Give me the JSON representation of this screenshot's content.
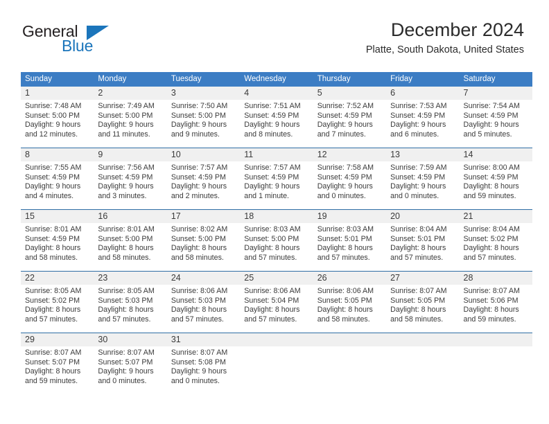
{
  "brand": {
    "name_part1": "General",
    "name_part2": "Blue",
    "triangle_icon": "blue-triangle-icon",
    "colors": {
      "dark": "#231f20",
      "blue": "#1b75bb"
    }
  },
  "header": {
    "title": "December 2024",
    "subtitle": "Platte, South Dakota, United States"
  },
  "theme": {
    "header_bar": "#3c7dc4",
    "week_rule": "#2e6da4",
    "daynum_band": "#f0f0f0",
    "text": "#3a3a3a"
  },
  "day_headers": [
    "Sunday",
    "Monday",
    "Tuesday",
    "Wednesday",
    "Thursday",
    "Friday",
    "Saturday"
  ],
  "weeks": [
    [
      {
        "day": "1",
        "sunrise": "Sunrise: 7:48 AM",
        "sunset": "Sunset: 5:00 PM",
        "daylight1": "Daylight: 9 hours",
        "daylight2": "and 12 minutes."
      },
      {
        "day": "2",
        "sunrise": "Sunrise: 7:49 AM",
        "sunset": "Sunset: 5:00 PM",
        "daylight1": "Daylight: 9 hours",
        "daylight2": "and 11 minutes."
      },
      {
        "day": "3",
        "sunrise": "Sunrise: 7:50 AM",
        "sunset": "Sunset: 5:00 PM",
        "daylight1": "Daylight: 9 hours",
        "daylight2": "and 9 minutes."
      },
      {
        "day": "4",
        "sunrise": "Sunrise: 7:51 AM",
        "sunset": "Sunset: 4:59 PM",
        "daylight1": "Daylight: 9 hours",
        "daylight2": "and 8 minutes."
      },
      {
        "day": "5",
        "sunrise": "Sunrise: 7:52 AM",
        "sunset": "Sunset: 4:59 PM",
        "daylight1": "Daylight: 9 hours",
        "daylight2": "and 7 minutes."
      },
      {
        "day": "6",
        "sunrise": "Sunrise: 7:53 AM",
        "sunset": "Sunset: 4:59 PM",
        "daylight1": "Daylight: 9 hours",
        "daylight2": "and 6 minutes."
      },
      {
        "day": "7",
        "sunrise": "Sunrise: 7:54 AM",
        "sunset": "Sunset: 4:59 PM",
        "daylight1": "Daylight: 9 hours",
        "daylight2": "and 5 minutes."
      }
    ],
    [
      {
        "day": "8",
        "sunrise": "Sunrise: 7:55 AM",
        "sunset": "Sunset: 4:59 PM",
        "daylight1": "Daylight: 9 hours",
        "daylight2": "and 4 minutes."
      },
      {
        "day": "9",
        "sunrise": "Sunrise: 7:56 AM",
        "sunset": "Sunset: 4:59 PM",
        "daylight1": "Daylight: 9 hours",
        "daylight2": "and 3 minutes."
      },
      {
        "day": "10",
        "sunrise": "Sunrise: 7:57 AM",
        "sunset": "Sunset: 4:59 PM",
        "daylight1": "Daylight: 9 hours",
        "daylight2": "and 2 minutes."
      },
      {
        "day": "11",
        "sunrise": "Sunrise: 7:57 AM",
        "sunset": "Sunset: 4:59 PM",
        "daylight1": "Daylight: 9 hours",
        "daylight2": "and 1 minute."
      },
      {
        "day": "12",
        "sunrise": "Sunrise: 7:58 AM",
        "sunset": "Sunset: 4:59 PM",
        "daylight1": "Daylight: 9 hours",
        "daylight2": "and 0 minutes."
      },
      {
        "day": "13",
        "sunrise": "Sunrise: 7:59 AM",
        "sunset": "Sunset: 4:59 PM",
        "daylight1": "Daylight: 9 hours",
        "daylight2": "and 0 minutes."
      },
      {
        "day": "14",
        "sunrise": "Sunrise: 8:00 AM",
        "sunset": "Sunset: 4:59 PM",
        "daylight1": "Daylight: 8 hours",
        "daylight2": "and 59 minutes."
      }
    ],
    [
      {
        "day": "15",
        "sunrise": "Sunrise: 8:01 AM",
        "sunset": "Sunset: 4:59 PM",
        "daylight1": "Daylight: 8 hours",
        "daylight2": "and 58 minutes."
      },
      {
        "day": "16",
        "sunrise": "Sunrise: 8:01 AM",
        "sunset": "Sunset: 5:00 PM",
        "daylight1": "Daylight: 8 hours",
        "daylight2": "and 58 minutes."
      },
      {
        "day": "17",
        "sunrise": "Sunrise: 8:02 AM",
        "sunset": "Sunset: 5:00 PM",
        "daylight1": "Daylight: 8 hours",
        "daylight2": "and 58 minutes."
      },
      {
        "day": "18",
        "sunrise": "Sunrise: 8:03 AM",
        "sunset": "Sunset: 5:00 PM",
        "daylight1": "Daylight: 8 hours",
        "daylight2": "and 57 minutes."
      },
      {
        "day": "19",
        "sunrise": "Sunrise: 8:03 AM",
        "sunset": "Sunset: 5:01 PM",
        "daylight1": "Daylight: 8 hours",
        "daylight2": "and 57 minutes."
      },
      {
        "day": "20",
        "sunrise": "Sunrise: 8:04 AM",
        "sunset": "Sunset: 5:01 PM",
        "daylight1": "Daylight: 8 hours",
        "daylight2": "and 57 minutes."
      },
      {
        "day": "21",
        "sunrise": "Sunrise: 8:04 AM",
        "sunset": "Sunset: 5:02 PM",
        "daylight1": "Daylight: 8 hours",
        "daylight2": "and 57 minutes."
      }
    ],
    [
      {
        "day": "22",
        "sunrise": "Sunrise: 8:05 AM",
        "sunset": "Sunset: 5:02 PM",
        "daylight1": "Daylight: 8 hours",
        "daylight2": "and 57 minutes."
      },
      {
        "day": "23",
        "sunrise": "Sunrise: 8:05 AM",
        "sunset": "Sunset: 5:03 PM",
        "daylight1": "Daylight: 8 hours",
        "daylight2": "and 57 minutes."
      },
      {
        "day": "24",
        "sunrise": "Sunrise: 8:06 AM",
        "sunset": "Sunset: 5:03 PM",
        "daylight1": "Daylight: 8 hours",
        "daylight2": "and 57 minutes."
      },
      {
        "day": "25",
        "sunrise": "Sunrise: 8:06 AM",
        "sunset": "Sunset: 5:04 PM",
        "daylight1": "Daylight: 8 hours",
        "daylight2": "and 57 minutes."
      },
      {
        "day": "26",
        "sunrise": "Sunrise: 8:06 AM",
        "sunset": "Sunset: 5:05 PM",
        "daylight1": "Daylight: 8 hours",
        "daylight2": "and 58 minutes."
      },
      {
        "day": "27",
        "sunrise": "Sunrise: 8:07 AM",
        "sunset": "Sunset: 5:05 PM",
        "daylight1": "Daylight: 8 hours",
        "daylight2": "and 58 minutes."
      },
      {
        "day": "28",
        "sunrise": "Sunrise: 8:07 AM",
        "sunset": "Sunset: 5:06 PM",
        "daylight1": "Daylight: 8 hours",
        "daylight2": "and 59 minutes."
      }
    ],
    [
      {
        "day": "29",
        "sunrise": "Sunrise: 8:07 AM",
        "sunset": "Sunset: 5:07 PM",
        "daylight1": "Daylight: 8 hours",
        "daylight2": "and 59 minutes."
      },
      {
        "day": "30",
        "sunrise": "Sunrise: 8:07 AM",
        "sunset": "Sunset: 5:07 PM",
        "daylight1": "Daylight: 9 hours",
        "daylight2": "and 0 minutes."
      },
      {
        "day": "31",
        "sunrise": "Sunrise: 8:07 AM",
        "sunset": "Sunset: 5:08 PM",
        "daylight1": "Daylight: 9 hours",
        "daylight2": "and 0 minutes."
      },
      {
        "day": "",
        "sunrise": "",
        "sunset": "",
        "daylight1": "",
        "daylight2": ""
      },
      {
        "day": "",
        "sunrise": "",
        "sunset": "",
        "daylight1": "",
        "daylight2": ""
      },
      {
        "day": "",
        "sunrise": "",
        "sunset": "",
        "daylight1": "",
        "daylight2": ""
      },
      {
        "day": "",
        "sunrise": "",
        "sunset": "",
        "daylight1": "",
        "daylight2": ""
      }
    ]
  ]
}
